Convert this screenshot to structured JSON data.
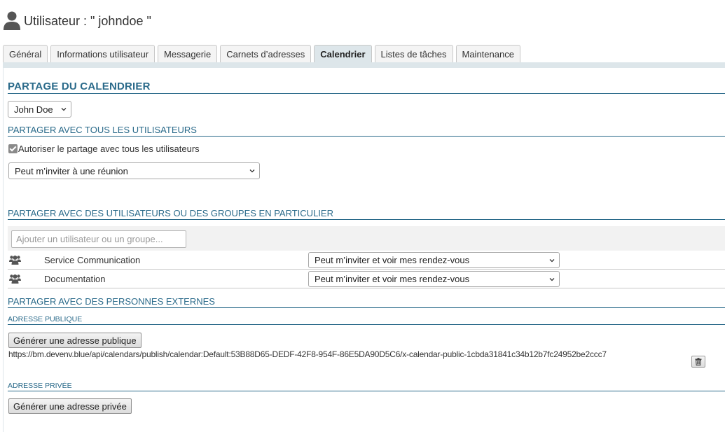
{
  "header": {
    "title": "Utilisateur : \" johndoe \"",
    "icon": "user-icon"
  },
  "tabs": [
    {
      "label": "Général",
      "active": false
    },
    {
      "label": "Informations utilisateur",
      "active": false
    },
    {
      "label": "Messagerie",
      "active": false
    },
    {
      "label": "Carnets d’adresses",
      "active": false
    },
    {
      "label": "Calendrier",
      "active": true
    },
    {
      "label": "Listes de tâches",
      "active": false
    },
    {
      "label": "Maintenance",
      "active": false
    }
  ],
  "calendar_sharing": {
    "title": "PARTAGE DU CALENDRIER",
    "calendar_select": "John Doe",
    "all_users": {
      "title": "PARTAGER AVEC TOUS LES UTILISATEURS",
      "checkbox_label": "Autoriser le partage avec tous les utilisateurs",
      "checkbox_checked": true,
      "permission_select": "Peut m’inviter à une réunion"
    },
    "specific": {
      "title": "PARTAGER AVEC DES UTILISATEURS OU DES GROUPES EN PARTICULIER",
      "search_placeholder": "Ajouter un utilisateur ou un groupe...",
      "entries": [
        {
          "name": "Service Communication",
          "permission": "Peut m’inviter et voir mes rendez-vous",
          "icon": "group-icon"
        },
        {
          "name": "Documentation",
          "permission": "Peut m’inviter et voir mes rendez-vous",
          "icon": "group-icon"
        }
      ]
    },
    "external": {
      "title": "PARTAGER AVEC DES PERSONNES EXTERNES",
      "public_title": "ADRESSE PUBLIQUE",
      "public_button": "Générer une adresse publique",
      "public_url": "https://bm.devenv.blue/api/calendars/publish/calendar:Default:53B88D65-DEDF-42F8-954F-86E5DA90D5C6/x-calendar-public-1cbda31841c34b12b7fc24952be2ccc7",
      "private_title": "ADRESSE PRIVÉE",
      "private_button": "Générer une adresse privée"
    }
  },
  "colors": {
    "accent": "#2a6a8a",
    "tab_active": "#dde6ea"
  }
}
